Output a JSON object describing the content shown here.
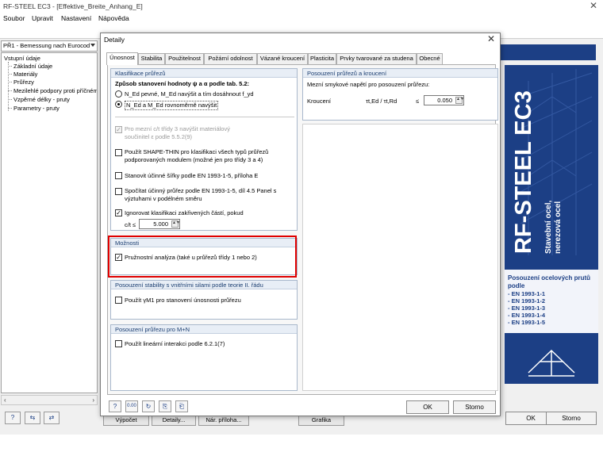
{
  "app": {
    "title": "RF-STEEL EC3 - [Effektive_Breite_Anhang_E]",
    "close_glyph": "✕",
    "menu": [
      "Soubor",
      "Upravit",
      "Nastavení",
      "Nápověda"
    ],
    "case_combo": "PŘ1 - Bemessung nach Eurocod",
    "tree": {
      "root": "Vstupní údaje",
      "items": [
        "Základní údaje",
        "Materiály",
        "Průřezy",
        "Mezilehlé podpory proti příčném",
        "Vzpěrné délky - pruty",
        "Parametry - pruty"
      ]
    },
    "bottom_buttons": [
      "Výpočet",
      "Detaily...",
      "Nár. příloha...",
      "Grafika"
    ],
    "ok_label": "OK",
    "cancel_label": "Storno"
  },
  "dialog": {
    "title": "Detaily",
    "close_glyph": "✕",
    "tabs": [
      "Únosnost",
      "Stabilita",
      "Použitelnost",
      "Požární odolnost",
      "Vázané kroucení",
      "Plasticita",
      "Prvky tvarované za studena",
      "Obecné"
    ],
    "active_tab": "Únosnost",
    "klasifikace": {
      "header": "Klasifikace průřezů",
      "method_label": "Způsob stanovení hodnoty ψ a α podle tab. 5.2:",
      "radio1": "N_Ed pevné, M_Ed navýšit a tím dosáhnout f_yd",
      "radio2": "N_Ed a M_Ed rovnoměrně navýšit",
      "radio_selected": 2,
      "opt_c3_line1": "Pro mezní c/t třídy 3 navýšit materiálový",
      "opt_c3_line2": "součinitel ε podle 5.5.2(9)",
      "opt_shape_line1": "Použít SHAPE-THIN pro klasifikaci všech typů průřezů",
      "opt_shape_line2": "podporovaných modulem (možné jen pro třídy 3 a 4)",
      "opt_width": "Stanovit účinné šířky podle EN 1993-1-5, příloha E",
      "opt_eff_line1": "Spočítat účinný průřez podle EN 1993-1-5, díl 4.5 Panel s",
      "opt_eff_line2": "výztuhami v podélném směru",
      "opt_ignore": "Ignorovat klasifikaci zakřivených částí, pokud",
      "ct_label": "c/t ≤",
      "ct_value": "5.000"
    },
    "moznosti": {
      "header": "Možnosti",
      "opt_elastic": "Pružnostní analýza (také u průřezů třídy 1 nebo 2)"
    },
    "stabilita": {
      "header": "Posouzení stability s vnitřními silami podle teorie II. řádu",
      "opt_gamma": "Použít γM1 pro stanovení únosnosti průřezu"
    },
    "mn": {
      "header": "Posouzení průřezu pro M+N",
      "opt_linear": "Použít lineární interakci podle 6.2.1(7)"
    },
    "torsion": {
      "header": "Posouzení průřezů a kroucení",
      "label": "Mezní smykové napětí pro posouzení průřezu:",
      "row_label": "Kroucení",
      "ratio": "τt,Ed / τt,Rd",
      "le": "≤",
      "value": "0.050"
    },
    "banner": {
      "product": "RF-STEEL EC3",
      "sub1": "Stavební ocel,",
      "sub2": "nerezová ocel",
      "desc": "Posouzení ocelových prutů podle",
      "norms": [
        "- EN 1993-1-1",
        "- EN 1993-1-2",
        "- EN 1993-1-3",
        "- EN 1993-1-4",
        "- EN 1993-1-5"
      ]
    },
    "ok_label": "OK",
    "cancel_label": "Storno"
  },
  "colors": {
    "brand_blue": "#1c3f85",
    "highlight_red": "#e00000"
  },
  "icons": [
    "help-icon",
    "units-icon",
    "reset-icon",
    "export-icon",
    "import-icon"
  ]
}
